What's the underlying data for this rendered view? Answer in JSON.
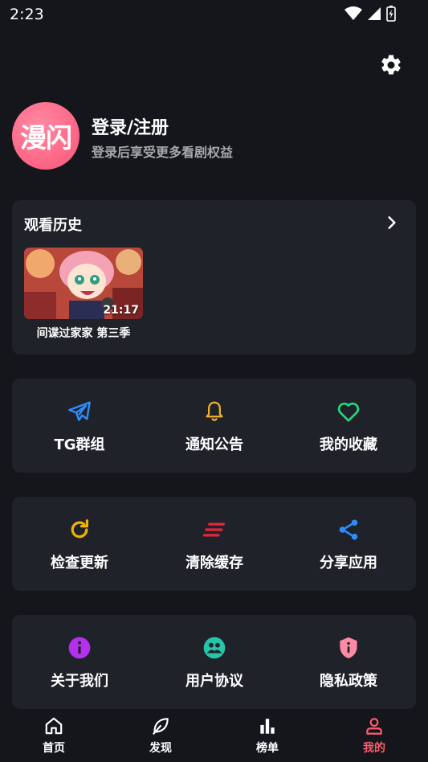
{
  "status_bar": {
    "time": "2:23"
  },
  "profile": {
    "avatar_text": "漫闪",
    "login_title": "登录/注册",
    "login_subtitle": "登录后享受更多看剧权益"
  },
  "history": {
    "title": "观看历史",
    "items": [
      {
        "name": "间谍过家家 第三季",
        "duration": "21:17"
      }
    ]
  },
  "grid1": {
    "items": [
      {
        "label": "TG群组",
        "icon": "telegram-icon",
        "color": "#2f8cff"
      },
      {
        "label": "通知公告",
        "icon": "bell-icon",
        "color": "#f0b030"
      },
      {
        "label": "我的收藏",
        "icon": "heart-icon",
        "color": "#22d97a"
      }
    ]
  },
  "grid2": {
    "items": [
      {
        "label": "检查更新",
        "icon": "refresh-icon",
        "color": "#f2b100"
      },
      {
        "label": "清除缓存",
        "icon": "clear-cache-icon",
        "color": "#e8253d"
      },
      {
        "label": "分享应用",
        "icon": "share-icon",
        "color": "#2f8cff"
      }
    ]
  },
  "grid3": {
    "items": [
      {
        "label": "关于我们",
        "icon": "info-icon",
        "color": "#b42ff0"
      },
      {
        "label": "用户协议",
        "icon": "user-agreement-icon",
        "color": "#26c4a8"
      },
      {
        "label": "隐私政策",
        "icon": "privacy-shield-icon",
        "color": "#ff8aa3"
      }
    ]
  },
  "bottom_nav": {
    "items": [
      {
        "label": "首页",
        "icon": "home-icon"
      },
      {
        "label": "发现",
        "icon": "leaf-icon"
      },
      {
        "label": "榜单",
        "icon": "chart-icon"
      },
      {
        "label": "我的",
        "icon": "person-icon"
      }
    ],
    "active_color": "#ff5c6e"
  }
}
